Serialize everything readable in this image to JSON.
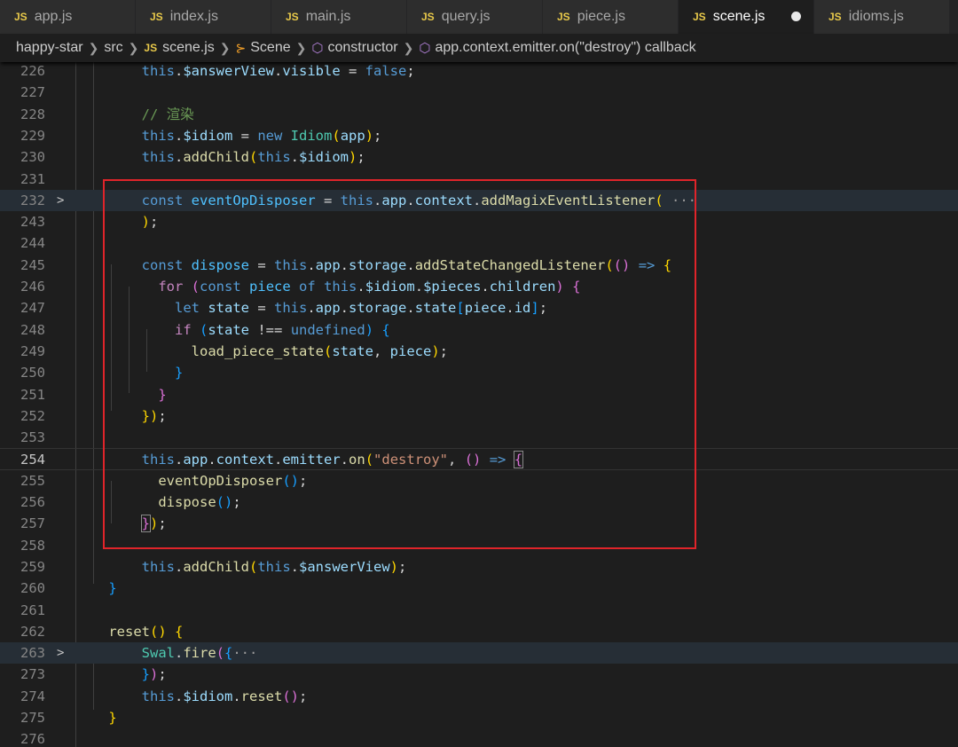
{
  "tabs": [
    {
      "label": "app.js",
      "badge": "JS"
    },
    {
      "label": "index.js",
      "badge": "JS"
    },
    {
      "label": "main.js",
      "badge": "JS"
    },
    {
      "label": "query.js",
      "badge": "JS"
    },
    {
      "label": "piece.js",
      "badge": "JS"
    },
    {
      "label": "scene.js",
      "badge": "JS",
      "active": true,
      "modified": true
    },
    {
      "label": "idioms.js",
      "badge": "JS"
    }
  ],
  "breadcrumb": {
    "project": "happy-star",
    "folder": "src",
    "file": "scene.js",
    "file_badge": "JS",
    "class": "Scene",
    "method": "constructor",
    "callback": "app.context.emitter.on(\"destroy\") callback"
  },
  "editor": {
    "line_numbers": [
      "226",
      "227",
      "228",
      "229",
      "230",
      "231",
      "232",
      "243",
      "244",
      "245",
      "246",
      "247",
      "248",
      "249",
      "250",
      "251",
      "252",
      "253",
      "254",
      "255",
      "256",
      "257",
      "258",
      "259",
      "260",
      "261",
      "262",
      "263",
      "273",
      "274",
      "275",
      "276"
    ],
    "current_line": "254",
    "comment_render": "// 渲染"
  },
  "colors": {
    "keyword": "#569cd6",
    "control": "#c586c0",
    "variable": "#9cdcfe",
    "function": "#dcdcaa",
    "class": "#4ec9b0",
    "string": "#ce9178",
    "comment": "#6a9955",
    "highlight_box": "#e0242a",
    "js_badge": "#e8c94a"
  }
}
